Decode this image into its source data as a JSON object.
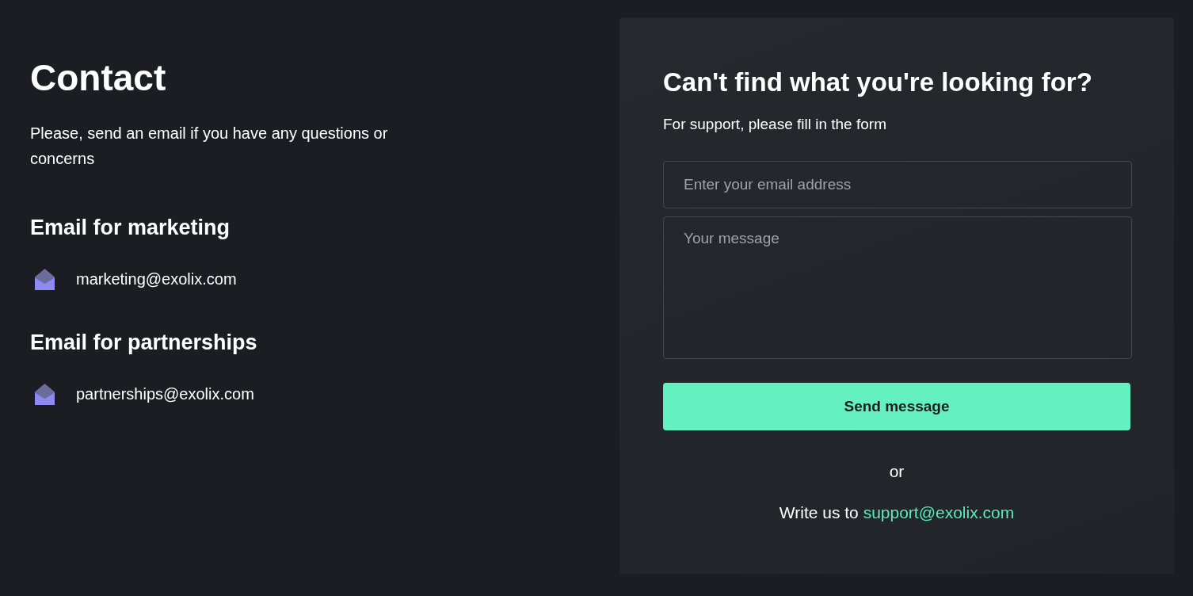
{
  "contact": {
    "title": "Contact",
    "intro": "Please, send an email if you have any questions or concerns",
    "sections": [
      {
        "heading": "Email for marketing",
        "email": "marketing@exolix.com"
      },
      {
        "heading": "Email for partnerships",
        "email": "partnerships@exolix.com"
      }
    ]
  },
  "support_form": {
    "title": "Can't find what you're looking for?",
    "subtitle": "For support, please fill in the form",
    "fields": [
      {
        "kind": "input",
        "placeholder": "Enter your email address"
      },
      {
        "kind": "textarea",
        "placeholder": "Your message"
      }
    ],
    "submit": "Send message",
    "separator": "or",
    "alternative": {
      "text": "Write us to",
      "link": "support@exolix.com"
    }
  }
}
